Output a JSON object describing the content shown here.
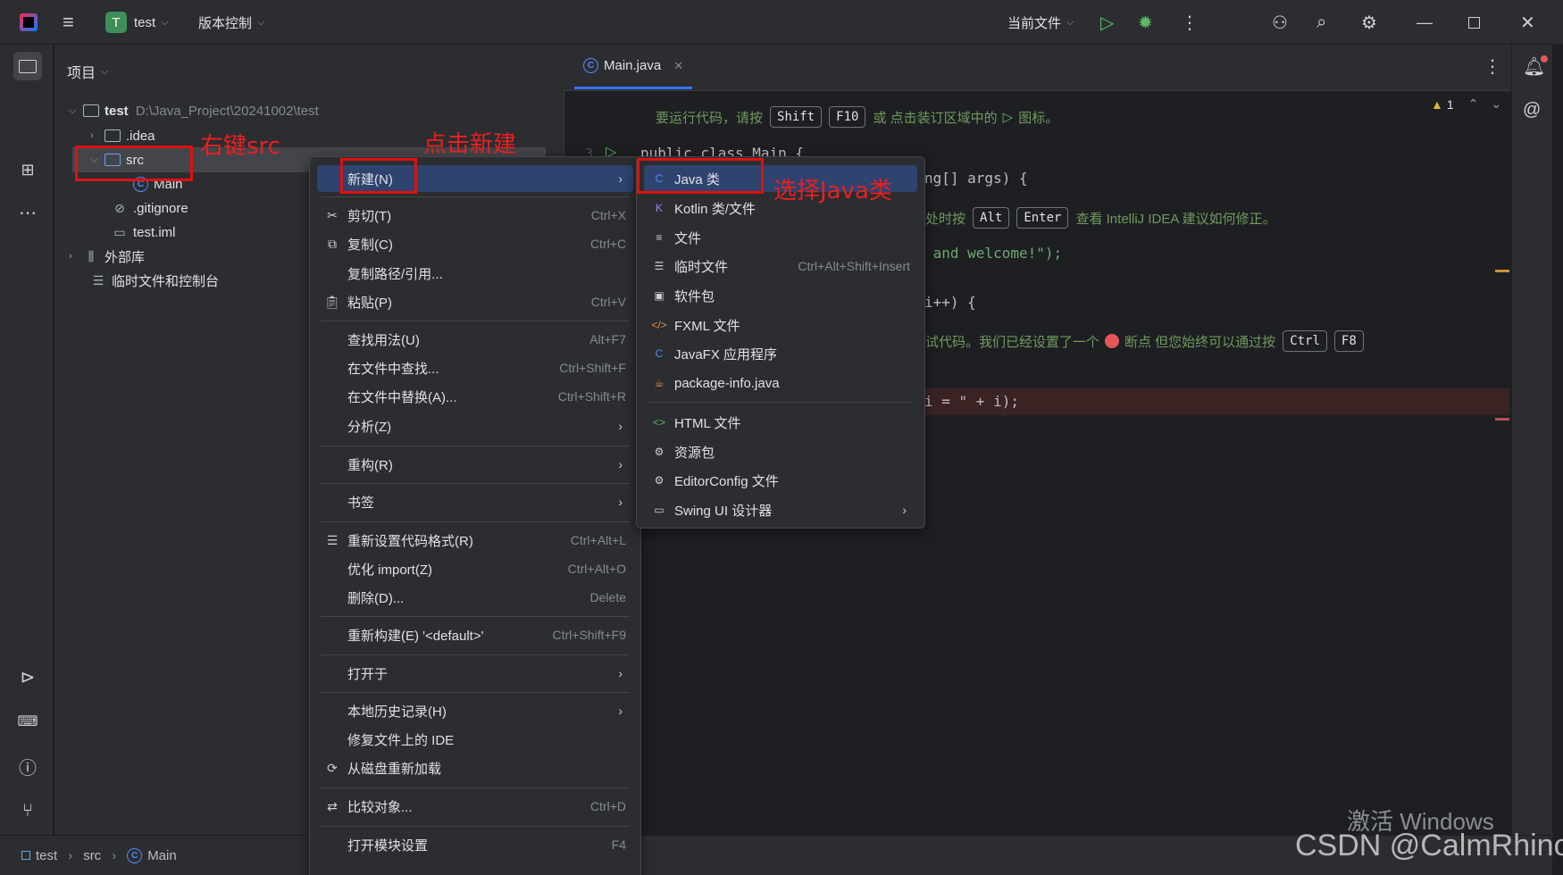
{
  "titlebar": {
    "project_badge": "T",
    "project_name": "test",
    "vcs_label": "版本控制",
    "run_config": "当前文件"
  },
  "project_panel": {
    "title": "项目",
    "tree": {
      "root_name": "test",
      "root_path": "D:\\Java_Project\\20241002\\test",
      "idea": ".idea",
      "src": "src",
      "main": "Main",
      "gitignore": ".gitignore",
      "iml": "test.iml",
      "external_libs": "外部库",
      "scratches": "临时文件和控制台"
    }
  },
  "editor": {
    "tab_label": "Main.java",
    "warning_count": "1",
    "hint1_prefix": "要运行代码，请按",
    "hint1_key1": "Shift",
    "hint1_key2": "F10",
    "hint1_suffix": "或 点击装订区域中的",
    "hint1_end": "图标。",
    "line_number": "3",
    "code_line1": "public class Main {",
    "code_line2": "ng[] args) {",
    "hint2_prefix": "处时按",
    "hint2_key1": "Alt",
    "hint2_key2": "Enter",
    "hint2_suffix": "查看 IntelliJ IDEA 建议如何修正。",
    "code_line3": " and welcome!\");",
    "code_line4": "i++) {",
    "hint3_prefix": "试代码。我们已经设置了一个",
    "hint3_mid": "断点 但您始终可以通过按",
    "hint3_key1": "Ctrl",
    "hint3_key2": "F8",
    "code_line5": "i = \" + i);"
  },
  "context_menu": {
    "items": [
      {
        "label": "新建(N)",
        "shortcut": "",
        "submenu": true
      },
      {
        "label": "剪切(T)",
        "shortcut": "Ctrl+X"
      },
      {
        "label": "复制(C)",
        "shortcut": "Ctrl+C"
      },
      {
        "label": "复制路径/引用...",
        "shortcut": ""
      },
      {
        "label": "粘贴(P)",
        "shortcut": "Ctrl+V"
      },
      {
        "label": "查找用法(U)",
        "shortcut": "Alt+F7"
      },
      {
        "label": "在文件中查找...",
        "shortcut": "Ctrl+Shift+F"
      },
      {
        "label": "在文件中替换(A)...",
        "shortcut": "Ctrl+Shift+R"
      },
      {
        "label": "分析(Z)",
        "shortcut": "",
        "submenu": true
      },
      {
        "label": "重构(R)",
        "shortcut": "",
        "submenu": true
      },
      {
        "label": "书签",
        "shortcut": "",
        "submenu": true
      },
      {
        "label": "重新设置代码格式(R)",
        "shortcut": "Ctrl+Alt+L"
      },
      {
        "label": "优化 import(Z)",
        "shortcut": "Ctrl+Alt+O"
      },
      {
        "label": "删除(D)...",
        "shortcut": "Delete"
      },
      {
        "label": "重新构建(E) '<default>'",
        "shortcut": "Ctrl+Shift+F9"
      },
      {
        "label": "打开于",
        "shortcut": "",
        "submenu": true
      },
      {
        "label": "本地历史记录(H)",
        "shortcut": "",
        "submenu": true
      },
      {
        "label": "修复文件上的 IDE",
        "shortcut": ""
      },
      {
        "label": "从磁盘重新加载",
        "shortcut": ""
      },
      {
        "label": "比较对象...",
        "shortcut": "Ctrl+D"
      },
      {
        "label": "打开模块设置",
        "shortcut": "F4"
      }
    ]
  },
  "submenu_new": {
    "items": [
      {
        "label": "Java 类",
        "shortcut": ""
      },
      {
        "label": "Kotlin 类/文件",
        "shortcut": ""
      },
      {
        "label": "文件",
        "shortcut": ""
      },
      {
        "label": "临时文件",
        "shortcut": "Ctrl+Alt+Shift+Insert"
      },
      {
        "label": "软件包",
        "shortcut": ""
      },
      {
        "label": "FXML 文件",
        "shortcut": ""
      },
      {
        "label": "JavaFX 应用程序",
        "shortcut": ""
      },
      {
        "label": "package-info.java",
        "shortcut": ""
      },
      {
        "label": "HTML 文件",
        "shortcut": ""
      },
      {
        "label": "资源包",
        "shortcut": ""
      },
      {
        "label": "EditorConfig 文件",
        "shortcut": ""
      },
      {
        "label": "Swing UI 设计器",
        "shortcut": "",
        "submenu": true
      }
    ]
  },
  "annotations": {
    "right_click_src": "右键src",
    "click_new": "点击新建",
    "select_java_class": "选择Java类"
  },
  "statusbar": {
    "crumb1": "test",
    "crumb2": "src",
    "crumb3": "Main"
  },
  "watermarks": {
    "activate": "激活 Windows",
    "csdn": "CSDN @CalmRhino"
  }
}
